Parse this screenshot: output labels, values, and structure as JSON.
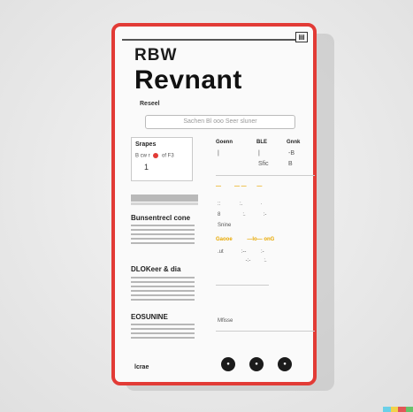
{
  "app": {
    "brand": "RBW",
    "title": "Revnant",
    "subtitle": "Reseel",
    "top_icon": "▤"
  },
  "search": {
    "placeholder": "Sachen Bl ooo Seer sluner"
  },
  "card": {
    "header": "Srapes",
    "row": "B cw r",
    "row_suffix": "of F3",
    "value": "1"
  },
  "columns": {
    "headers": [
      "Goenn",
      "BLE",
      "Gnnk"
    ],
    "row1": [
      "|",
      "|",
      "-B"
    ],
    "row2": [
      "",
      "Sfic",
      "B"
    ]
  },
  "sections": [
    {
      "label": "Bunsentrecl cone"
    },
    {
      "label": "DLOKeer & dia"
    },
    {
      "label": "EOSUNINE"
    }
  ],
  "right_panel": {
    "yellow_row_1": [
      "—",
      "— —",
      "—"
    ],
    "yellow_row_2": [
      "Gaooe",
      "—lo— onG"
    ],
    "label": "Snine",
    "footer_label": "Mfisse"
  },
  "footer": {
    "label": "lcrae",
    "dots": [
      "●",
      "●",
      "●"
    ]
  },
  "colors": {
    "accent": "#e23b36",
    "yellow": "#e8a800",
    "bar": [
      "#6bd0e8",
      "#f1d24a",
      "#e25757",
      "#67c36b"
    ]
  }
}
